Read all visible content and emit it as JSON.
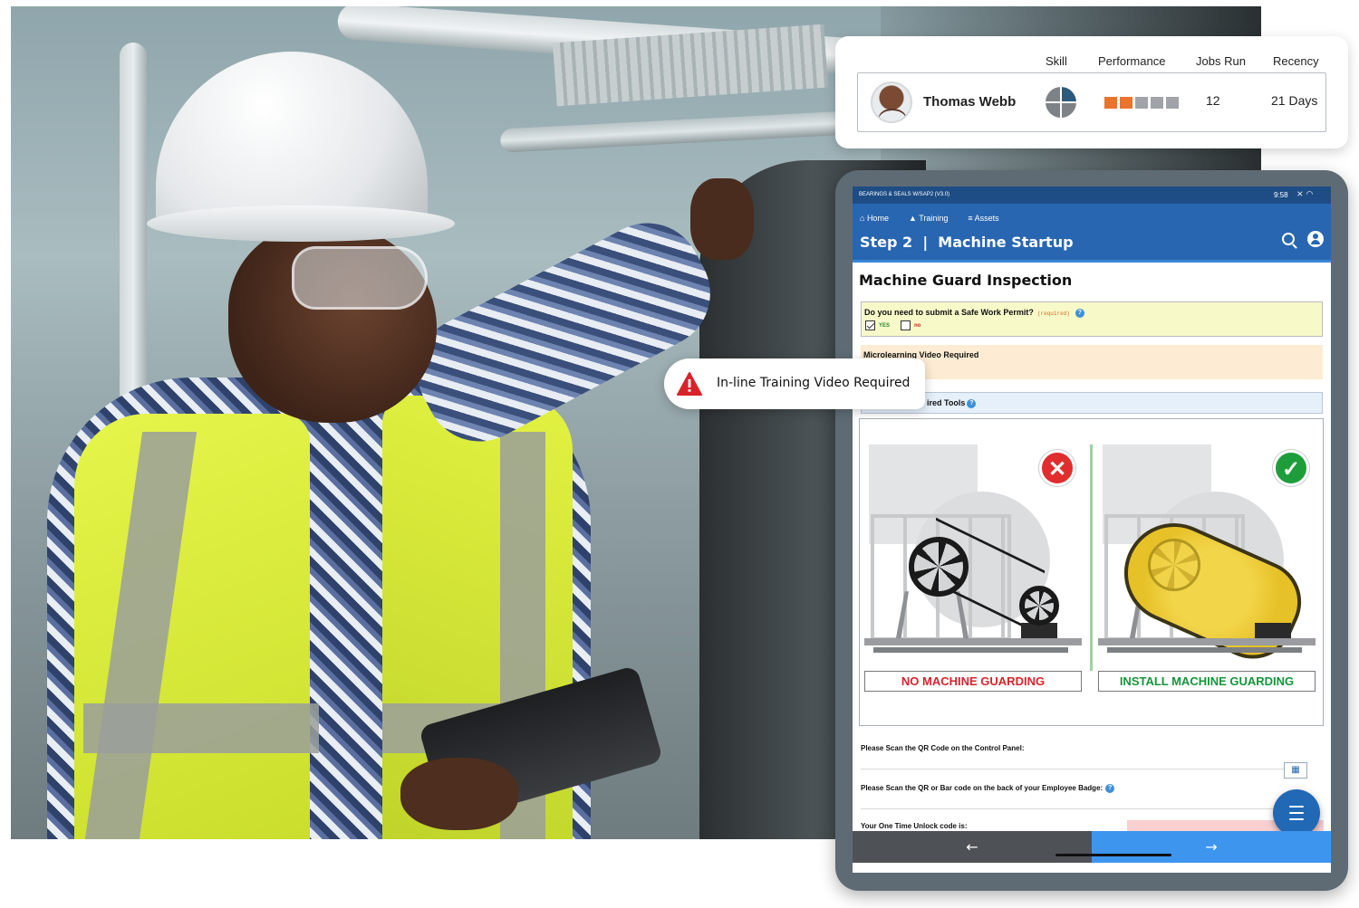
{
  "profile_card": {
    "headers": {
      "skill": "Skill",
      "performance": "Performance",
      "jobs_run": "Jobs Run",
      "recency": "Recency"
    },
    "worker": {
      "name": "Thomas Webb",
      "jobs_run": "12",
      "recency": "21 Days"
    },
    "performance_rating": {
      "filled": 2,
      "total": 5
    },
    "skill_quarters_filled": 1,
    "colors": {
      "performance_filled": "#e8742e",
      "performance_empty": "#a0a4a8",
      "skill_filled": "#2c5a7c",
      "skill_empty": "#7d8286"
    }
  },
  "callout": {
    "text": "In-line Training Video Required",
    "icon": "warning-icon"
  },
  "tablet": {
    "status_bar": {
      "title": "BEARINGS & SEALS W/SAP2 (V3.0)",
      "time": "9:58",
      "icons": [
        "mute-icon",
        "wifi-icon"
      ]
    },
    "nav": {
      "home": "Home",
      "training": "Training",
      "assets": "Assets"
    },
    "step_title": "Step 2  |  Machine Startup",
    "section_title": "Machine Guard Inspection",
    "permit": {
      "question": "Do you need to submit a Safe Work Permit?",
      "required_tag": "(required)",
      "yes_label": "YES",
      "no_label": "no",
      "yes_checked": true,
      "no_checked": false
    },
    "microlearning_label": "Microlearning Video Required",
    "tools_label": "ired Tools",
    "images": {
      "bad_caption": "NO MACHINE GUARDING",
      "good_caption": "INSTALL MACHINE GUARDING",
      "bad_icon": "x-icon",
      "good_icon": "check-icon"
    },
    "scan_control_panel": "Please Scan the QR Code on the Control Panel:",
    "scan_badge": "Please Scan the QR or Bar code on the back of your Employee Badge:",
    "unlock_label": "Your One Time Unlock code is:",
    "bottom_nav": {
      "back_icon": "←",
      "next_icon": "→"
    },
    "colors": {
      "status_bar": "#1e4d86",
      "app_bar": "#2866b1",
      "next_button": "#3d95ee",
      "back_button": "#4e5257"
    }
  }
}
